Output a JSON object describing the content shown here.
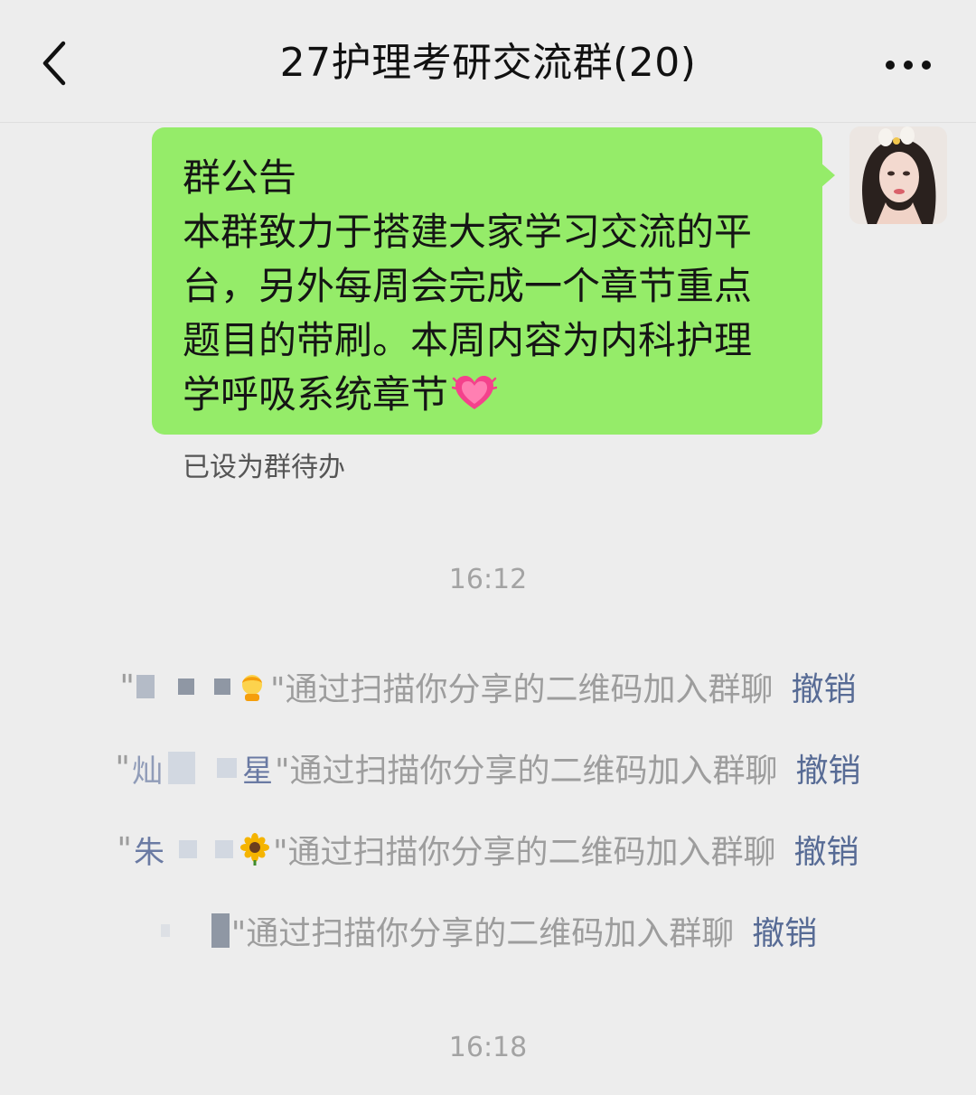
{
  "header": {
    "title": "27护理考研交流群(20)"
  },
  "announcement": {
    "title": "群公告",
    "body": "本群致力于搭建大家学习交流的平台，另外每周会完成一个章节重点题目的带刷。本周内容为内科护理学呼吸系统章节",
    "line1": "本群致力于搭建大家学习交流的平",
    "line2": "台，另外每周会完成一个章节重点",
    "line3": "题目的带刷。本周内容为内科护理",
    "line4": "学呼吸系统章节",
    "todo_note": "已设为群待办"
  },
  "timestamps": {
    "first": "16:12",
    "second": "16:18"
  },
  "system_messages": [
    {
      "name_visible": "",
      "text": "\"通过扫描你分享的二维码加入群聊",
      "action": "撤销"
    },
    {
      "name_visible": "星",
      "name_prefix": "灿",
      "text": "\"通过扫描你分享的二维码加入群聊",
      "action": "撤销"
    },
    {
      "name_visible": "",
      "name_prefix": "朱",
      "text": "\"通过扫描你分享的二维码加入群聊",
      "action": "撤销"
    },
    {
      "name_visible": "",
      "text": "\"通过扫描你分享的二维码加入群聊",
      "action": "撤销"
    }
  ],
  "colors": {
    "background": "#ededed",
    "bubble_green": "#95ec69",
    "link_blue": "#576b95",
    "system_gray": "#9d9d9d"
  },
  "icons": {
    "back": "chevron-left-icon",
    "more": "more-dots-icon",
    "heart": "growing-heart-icon",
    "sunflower": "sunflower-icon",
    "person": "person-emoji-icon"
  }
}
